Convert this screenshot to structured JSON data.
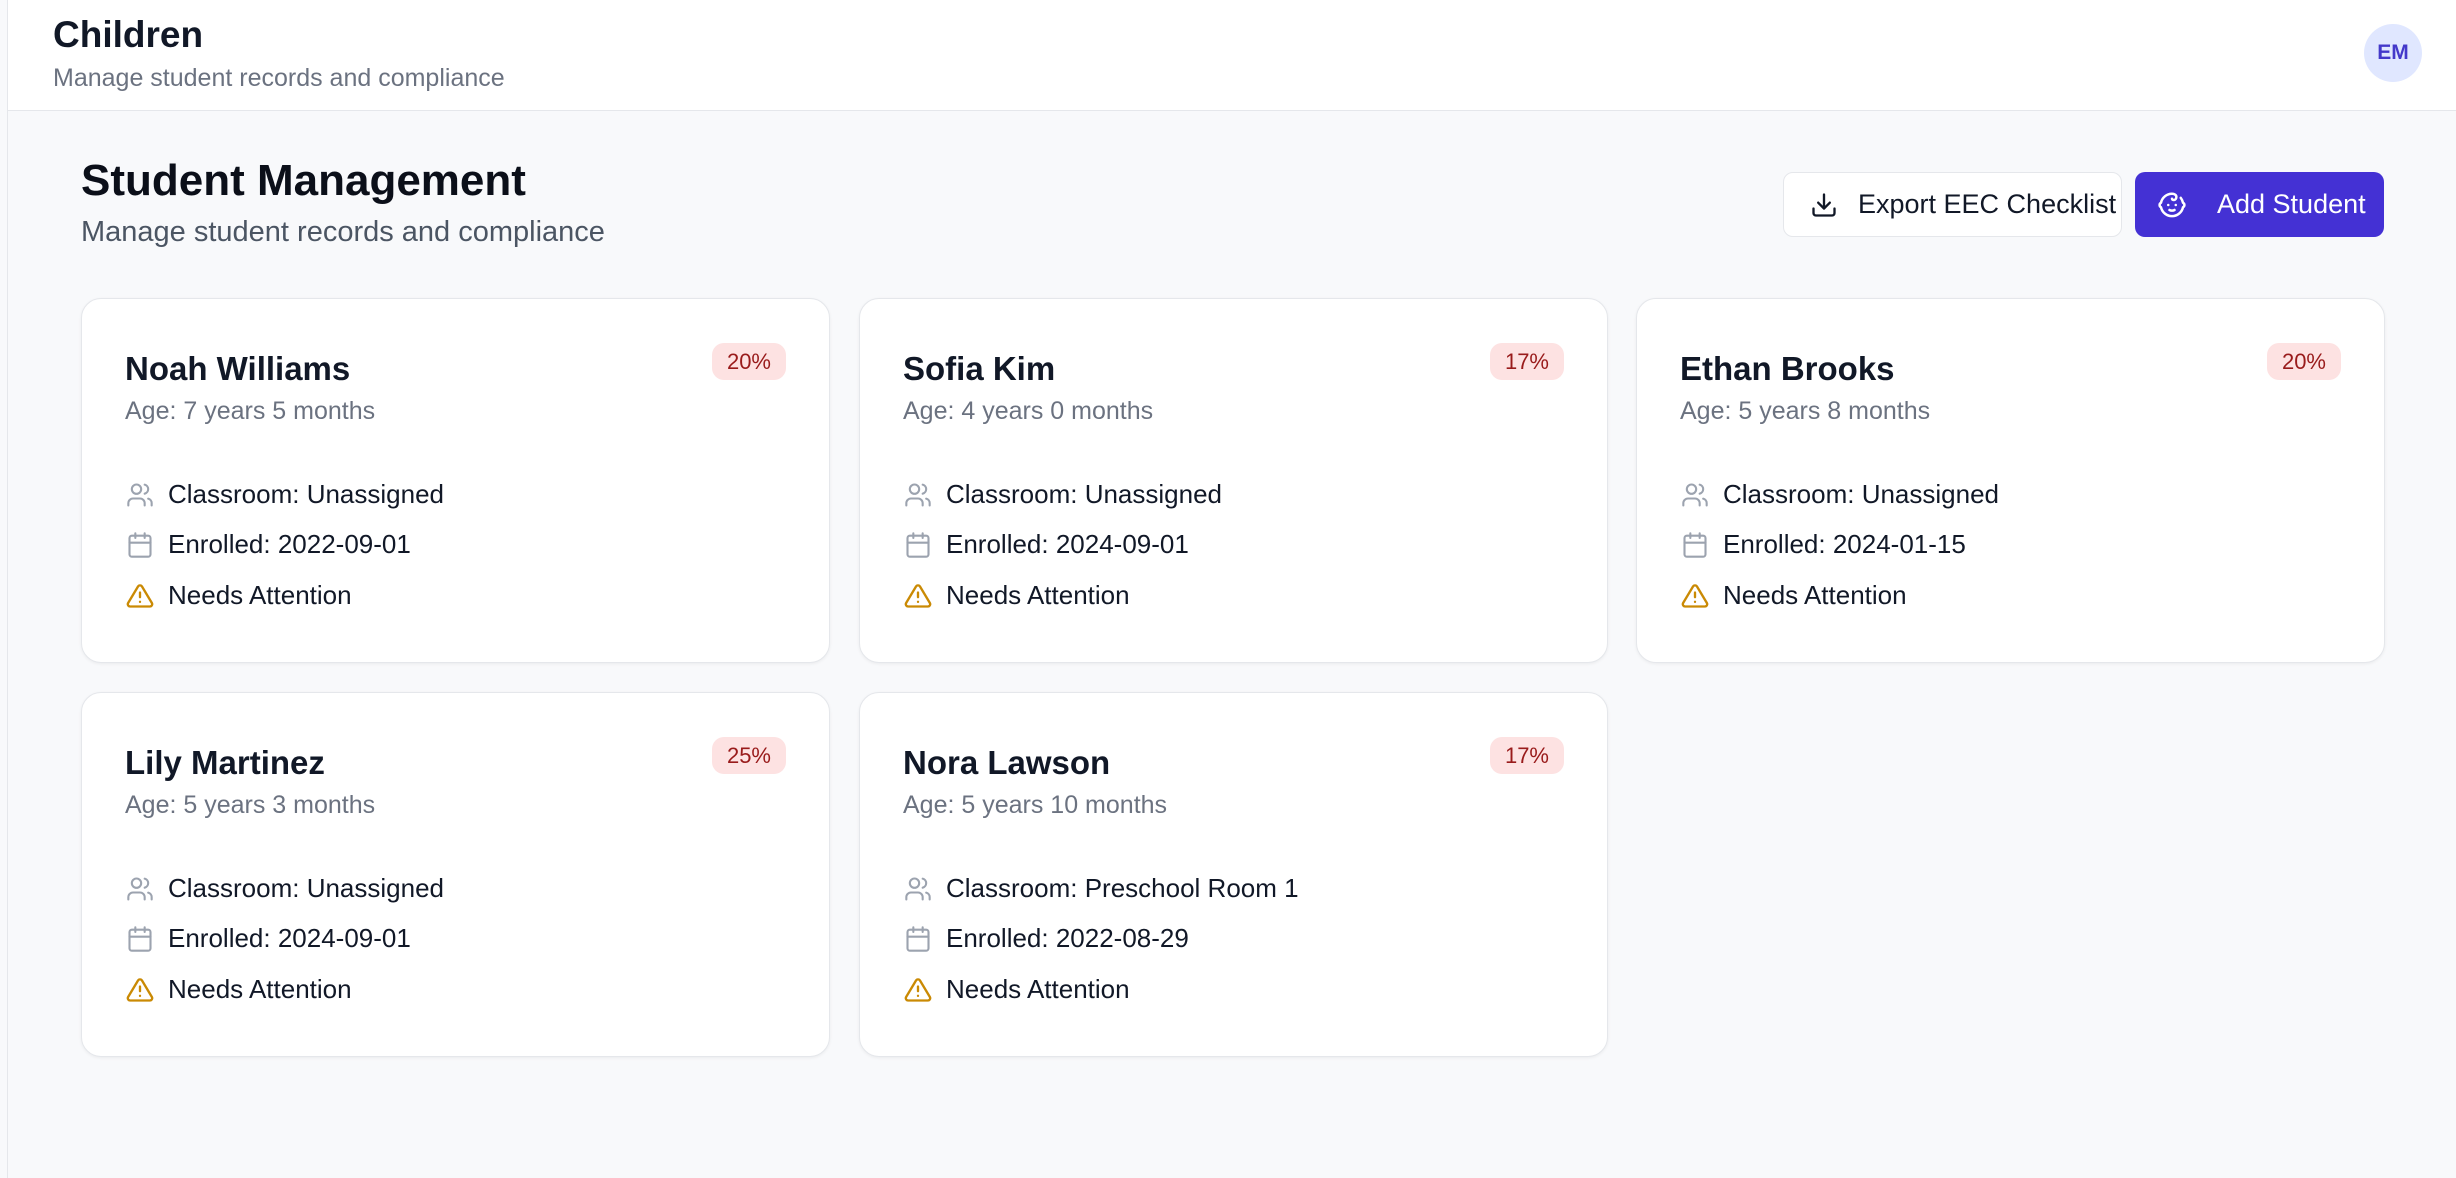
{
  "header": {
    "title": "Children",
    "subtitle": "Manage student records and compliance",
    "avatar_initials": "EM"
  },
  "page": {
    "title": "Student Management",
    "subtitle": "Manage student records and compliance"
  },
  "actions": {
    "export_label": "Export EEC Checklist",
    "add_label": "Add Student"
  },
  "students": [
    {
      "name": "Noah Williams",
      "age": "Age: 7 years 5 months",
      "badge": "20%",
      "classroom": "Classroom: Unassigned",
      "enrolled": "Enrolled: 2022-09-01",
      "status": "Needs Attention"
    },
    {
      "name": "Sofia Kim",
      "age": "Age: 4 years 0 months",
      "badge": "17%",
      "classroom": "Classroom: Unassigned",
      "enrolled": "Enrolled: 2024-09-01",
      "status": "Needs Attention"
    },
    {
      "name": "Ethan Brooks",
      "age": "Age: 5 years 8 months",
      "badge": "20%",
      "classroom": "Classroom: Unassigned",
      "enrolled": "Enrolled: 2024-01-15",
      "status": "Needs Attention"
    },
    {
      "name": "Lily Martinez",
      "age": "Age: 5 years 3 months",
      "badge": "25%",
      "classroom": "Classroom: Unassigned",
      "enrolled": "Enrolled: 2024-09-01",
      "status": "Needs Attention"
    },
    {
      "name": "Nora Lawson",
      "age": "Age: 5 years 10 months",
      "badge": "17%",
      "classroom": "Classroom: Preschool Room 1",
      "enrolled": "Enrolled: 2022-08-29",
      "status": "Needs Attention"
    }
  ],
  "colors": {
    "primary": "#4431d4",
    "badge_bg": "#fde2e2",
    "badge_text": "#991b1b",
    "warning": "#ca8a04"
  },
  "icons": {
    "classroom": "users-icon",
    "enrolled": "calendar-icon",
    "status": "warning-icon",
    "export": "download-icon",
    "add": "baby-icon"
  }
}
